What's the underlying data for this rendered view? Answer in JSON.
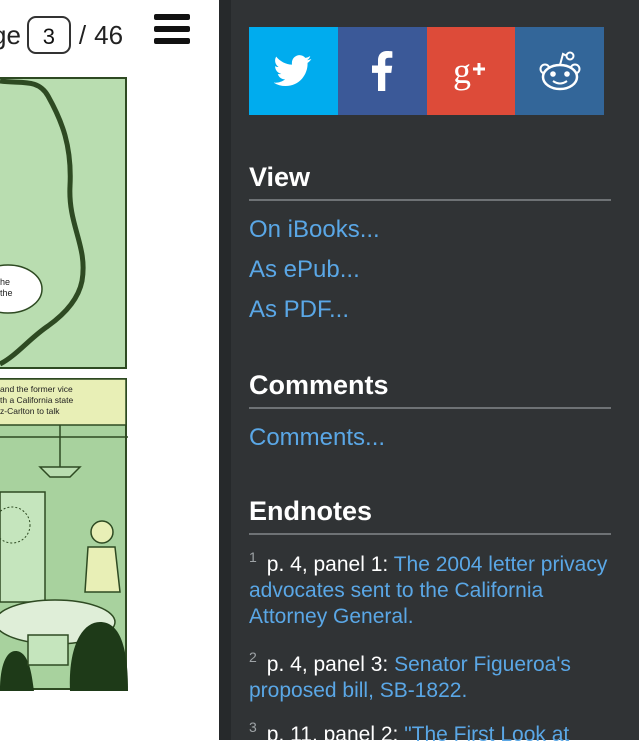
{
  "reader": {
    "page_label": "ge",
    "page_current": "3",
    "page_separator": "/",
    "page_total": "46",
    "menu_icon": "hamburger-icon",
    "comic_text_top": [
      "he",
      "the"
    ],
    "comic_text_bottom": [
      "and the former vice",
      "th a California state",
      "z-Carlton to talk"
    ]
  },
  "share": {
    "buttons": [
      {
        "name": "twitter",
        "icon": "twitter-icon",
        "color": "#00acee"
      },
      {
        "name": "facebook",
        "icon": "facebook-icon",
        "color": "#3b5998"
      },
      {
        "name": "google-plus",
        "icon": "google-plus-icon",
        "color": "#dd4b39"
      },
      {
        "name": "reddit",
        "icon": "reddit-icon",
        "color": "#336699"
      }
    ]
  },
  "view": {
    "heading": "View",
    "links": [
      "On iBooks...",
      "As ePub...",
      "As PDF..."
    ]
  },
  "comments": {
    "heading": "Comments",
    "link": "Comments..."
  },
  "endnotes": {
    "heading": "Endnotes",
    "items": [
      {
        "num": "1",
        "ref": "p. 4, panel 1:",
        "link": "The 2004 letter privacy advocates sent to the California Attorney General."
      },
      {
        "num": "2",
        "ref": "p. 4, panel 3:",
        "link": "Senator Figueroa's proposed bill, SB-1822."
      },
      {
        "num": "3",
        "ref": "p. 11, panel 2:",
        "link": "\"The First Look at"
      }
    ]
  },
  "colors": {
    "sidebar_bg": "#303335",
    "link": "#5aa7e6",
    "comic_green": "#b9ddb0",
    "comic_dark": "#2e4a22"
  }
}
